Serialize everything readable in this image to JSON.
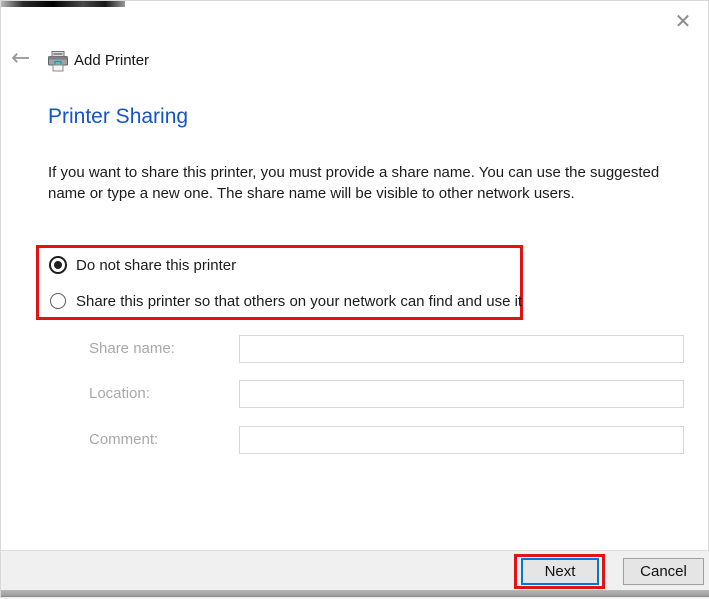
{
  "window": {
    "title": "Add Printer",
    "icons": {
      "back": "←",
      "close": "✕",
      "printer": "printer-icon"
    }
  },
  "content": {
    "heading": "Printer Sharing",
    "description_line1": "If you want to share this printer, you must provide a share name. You can use the suggested",
    "description_line2": "name or type a new one. The share name will be visible to other network users."
  },
  "radio_group": {
    "name": "printer-sharing-options",
    "options": [
      {
        "label": "Do not share this printer",
        "selected": true
      },
      {
        "label": "Share this printer so that others on your network can find and use it",
        "selected": false
      }
    ]
  },
  "form": {
    "fields": [
      {
        "label": "Share name:",
        "value": "",
        "disabled": true
      },
      {
        "label": "Location:",
        "value": "",
        "disabled": true
      },
      {
        "label": "Comment:",
        "value": "",
        "disabled": true
      }
    ]
  },
  "footer": {
    "next_label": "Next",
    "cancel_label": "Cancel"
  },
  "annotations": {
    "highlight_color": "#e01414",
    "highlighted_elements": [
      "sharing-options-radio-group",
      "next-button"
    ]
  },
  "colors": {
    "heading_blue": "#1553c8",
    "accent_blue": "#0078d7",
    "footer_gray": "#f0f0f0",
    "disabled_label_gray": "#a9a9a9"
  }
}
